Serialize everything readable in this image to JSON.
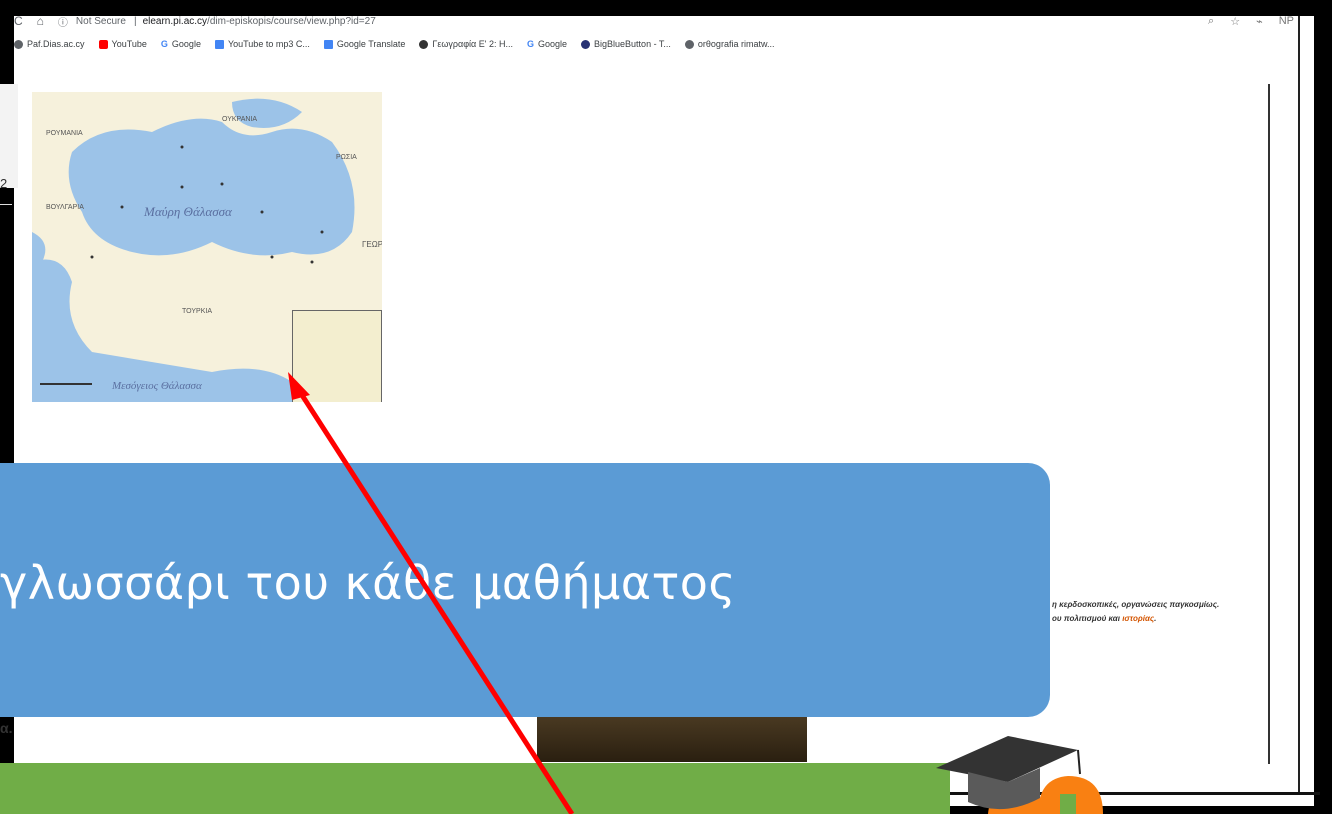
{
  "browser": {
    "not_secure": "Not Secure",
    "url_host": "elearn.pi.ac.cy",
    "url_path": "/dim-episkopis/course/view.php?id=27",
    "profile": "NP"
  },
  "bookmarks": [
    {
      "label": "Paf.Dias.ac.cy",
      "color": "#5f6368"
    },
    {
      "label": "YouTube",
      "color": "#ff0000"
    },
    {
      "label": "Google",
      "color": "#4285f4"
    },
    {
      "label": "YouTube to mp3 C...",
      "color": "#4285f4"
    },
    {
      "label": "Google Translate",
      "color": "#4285f4"
    },
    {
      "label": "Γεωγραφία Ε' 2: Η...",
      "color": "#333333"
    },
    {
      "label": "Google",
      "color": "#4285f4"
    },
    {
      "label": "BigBlueButton - T...",
      "color": "#283274"
    },
    {
      "label": "orθografia rimatw...",
      "color": "#5f6368"
    }
  ],
  "map": {
    "labels": {
      "ukraine": "ΟΥΚΡΑΝΙΑ",
      "romania": "ΡΟΥΜΑΝΙΑ",
      "russia": "ΡΩΣΙΑ",
      "bulgaria": "ΒΟΥΛΓΑΡΙΑ",
      "turkey": "ΤΟΥΡΚΙΑ",
      "georgia": "ΓΕΩΡ"
    },
    "sea_black": "Μαύρη Θάλασσα",
    "sea_med": "Μεσόγειος Θάλασσα"
  },
  "left_page_fragment": "2",
  "bottom_left_fragment": "α.",
  "right_text": {
    "line1": "η κερδοσκοπικές, οργανώσεις παγκοσμίως.",
    "line2_pre": "ου πολιτισμού και ",
    "line2_hl": "ιστορίας",
    "line2_post": "."
  },
  "callout": {
    "text": "γλωσσάρι του κάθε μαθήματος",
    "color": "#5b9bd5"
  },
  "banner_color": "#70ad47",
  "arrow_color": "#ff0000"
}
